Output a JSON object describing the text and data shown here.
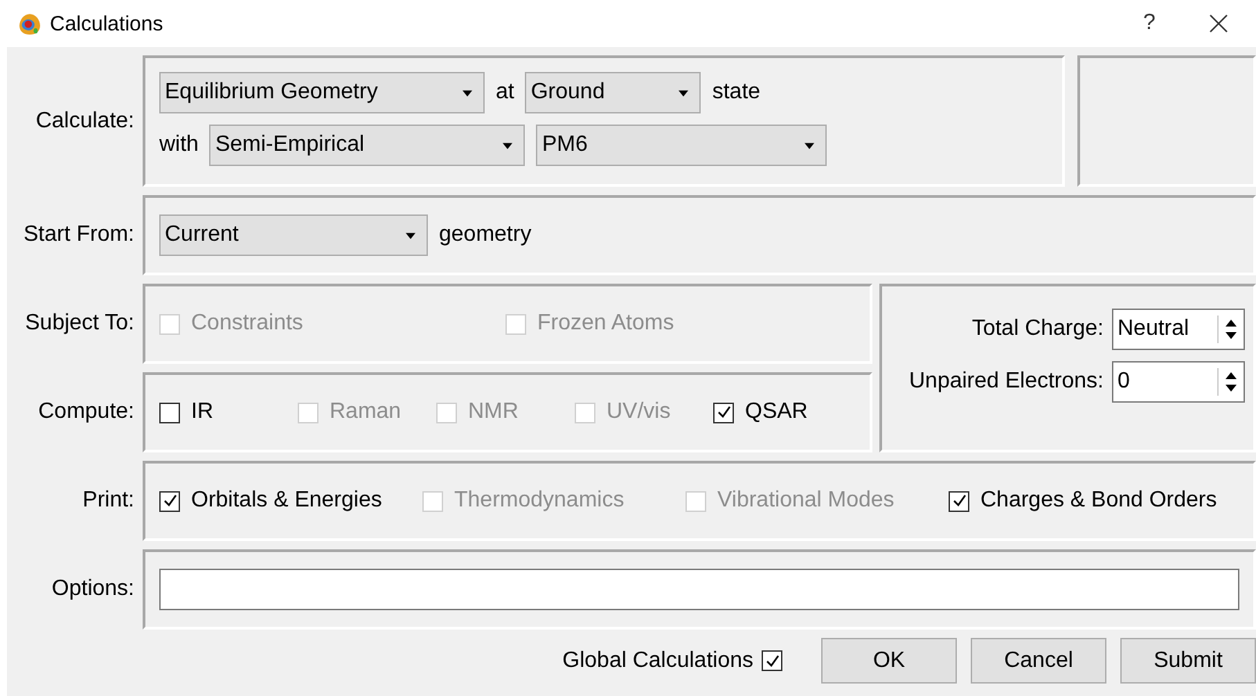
{
  "window": {
    "title": "Calculations",
    "help": "?"
  },
  "calculate": {
    "label": "Calculate:",
    "task": "Equilibrium Geometry",
    "at": "at",
    "state": "Ground",
    "state_suffix": "state",
    "with": "with",
    "method": "Semi-Empirical",
    "model": "PM6"
  },
  "start_from": {
    "label": "Start From:",
    "value": "Current",
    "suffix": "geometry"
  },
  "subject_to": {
    "label": "Subject To:",
    "options": [
      {
        "label": "Constraints",
        "checked": false,
        "disabled": true
      },
      {
        "label": "Frozen Atoms",
        "checked": false,
        "disabled": true
      }
    ]
  },
  "compute": {
    "label": "Compute:",
    "options": [
      {
        "label": "IR",
        "checked": false,
        "disabled": false
      },
      {
        "label": "Raman",
        "checked": false,
        "disabled": true
      },
      {
        "label": "NMR",
        "checked": false,
        "disabled": true
      },
      {
        "label": "UV/vis",
        "checked": false,
        "disabled": true
      },
      {
        "label": "QSAR",
        "checked": true,
        "disabled": false
      }
    ]
  },
  "spin_fields": [
    {
      "label": "Total Charge:",
      "value": "Neutral"
    },
    {
      "label": "Unpaired Electrons:",
      "value": "0"
    }
  ],
  "print": {
    "label": "Print:",
    "options": [
      {
        "label": "Orbitals & Energies",
        "checked": true,
        "disabled": false
      },
      {
        "label": "Thermodynamics",
        "checked": false,
        "disabled": true
      },
      {
        "label": "Vibrational Modes",
        "checked": false,
        "disabled": true
      },
      {
        "label": "Charges & Bond Orders",
        "checked": true,
        "disabled": false
      }
    ]
  },
  "options": {
    "label": "Options:"
  },
  "footer": {
    "global": {
      "label": "Global Calculations",
      "checked": true
    },
    "buttons": [
      "OK",
      "Cancel",
      "Submit"
    ]
  }
}
